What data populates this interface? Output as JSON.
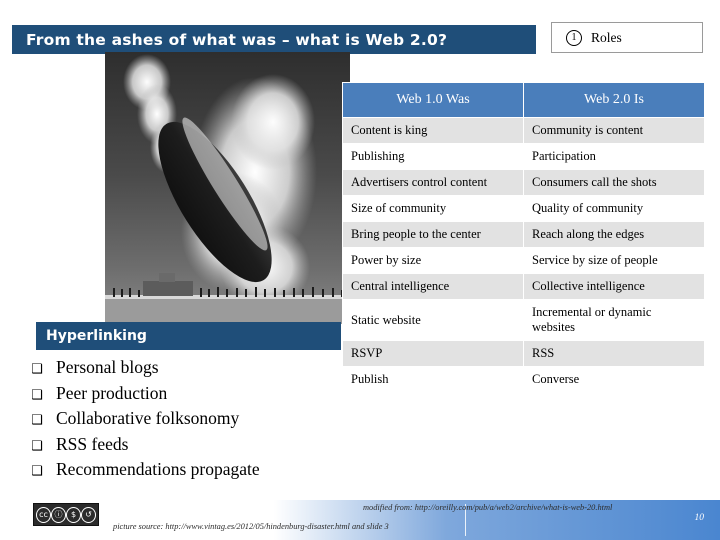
{
  "slide": {
    "title": "From the ashes of what was – what is Web 2.0?",
    "page_number": "10",
    "accent_dark_blue": "#1F4E79",
    "accent_header_blue": "#4A7EBB",
    "row_shade": "#E2E2E2"
  },
  "roles_box": {
    "number": "1",
    "label": "Roles"
  },
  "photo": {
    "alt": "Hindenburg airship disaster photograph"
  },
  "hyperlinking": {
    "heading": "Hyperlinking",
    "items": [
      {
        "bullet": "❑",
        "label": "Personal blogs"
      },
      {
        "bullet": "❑",
        "label": "Peer production"
      },
      {
        "bullet": "❑",
        "label": "Collaborative folksonomy"
      },
      {
        "bullet": "❑",
        "label": "RSS feeds"
      },
      {
        "bullet": "❑",
        "label": "Recommendations propagate"
      }
    ]
  },
  "table": {
    "headers": [
      "Web 1.0 Was",
      "Web 2.0 Is"
    ],
    "rows": [
      {
        "web1": "Content is king",
        "web2": "Community is content"
      },
      {
        "web1": "Publishing",
        "web2": "Participation"
      },
      {
        "web1": "Advertisers control content",
        "web2": "Consumers call the shots"
      },
      {
        "web1": "Size of community",
        "web2": "Quality of community"
      },
      {
        "web1": "Bring people to the center",
        "web2": "Reach along the edges"
      },
      {
        "web1": "Power by size",
        "web2": "Service by size of people"
      },
      {
        "web1": "Central intelligence",
        "web2": "Collective intelligence"
      },
      {
        "web1": "Static website",
        "web2": "Incremental or dynamic websites"
      },
      {
        "web1": "RSVP",
        "web2": "RSS"
      },
      {
        "web1": "Publish",
        "web2": "Converse"
      }
    ]
  },
  "footer": {
    "picture_source": "picture source: http://www.vintag.es/2012/05/hindenburg-disaster.html and slide 3",
    "modified_from": "modified from: http://oreilly.com/pub/a/web2/archive/what-is-web-20.html",
    "cc_icons": [
      "cc",
      "by",
      "nc",
      "sa"
    ]
  }
}
